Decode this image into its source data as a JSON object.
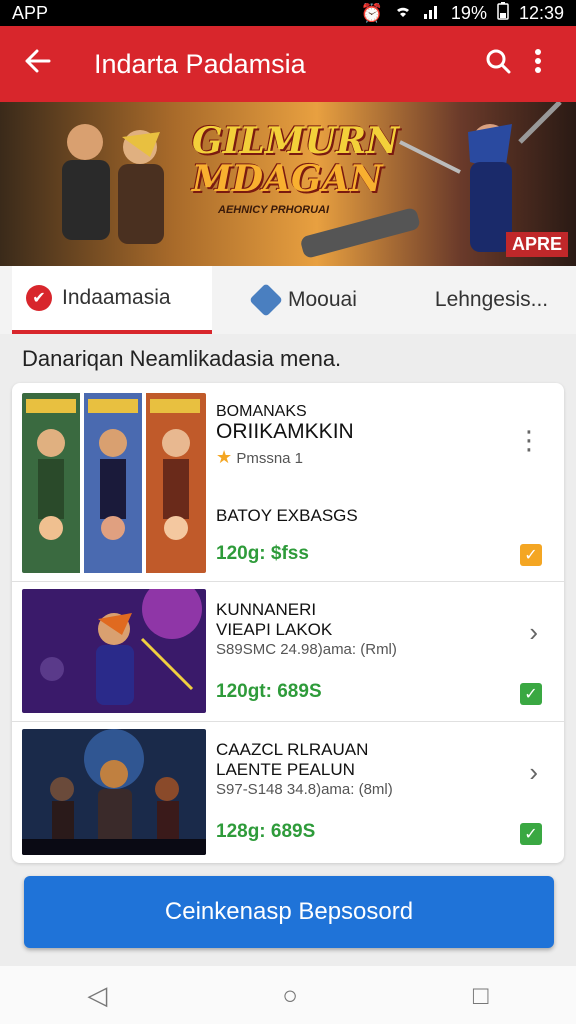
{
  "status": {
    "app": "APP",
    "battery": "19%",
    "time": "12:39",
    "icons": [
      "alarm-icon",
      "wifi-icon",
      "signal-icon",
      "battery-icon"
    ]
  },
  "appbar": {
    "title": "Indarta Padamsia",
    "back_icon": "back-arrow-icon",
    "search_icon": "search-icon",
    "menu_icon": "more-vert-icon"
  },
  "banner": {
    "title1": "GILMURN",
    "title2": "MDAGAN",
    "tagline": "AEHNICY PRHORUAI",
    "badge": "APRE"
  },
  "tabs": [
    {
      "label": "Indaamasia",
      "icon": "brand-badge-icon"
    },
    {
      "label": "Moouai",
      "icon": "shield-icon"
    },
    {
      "label": "Lehngesis..."
    }
  ],
  "subtitle": "Danariqan Neamlikadasia mena.",
  "items": [
    {
      "title1": "BOMANAKS",
      "title2": "ORIIKAMKKIN",
      "rating": "Pmssna 1",
      "subtitle": "BATOY EXBASGS",
      "price": "120g: $fss",
      "status_color": "#f4a623"
    },
    {
      "title1": "KUNNANERI",
      "title2": "VIEAPI LAKOK",
      "meta": "S89SMC 24.98)ama: (Rml)",
      "price": "120gt: 689S",
      "status_color": "#3aa842"
    },
    {
      "title1": "CAAZCL RLRAUAN",
      "title2": "LAENTE PEALUN",
      "meta": "S97-S148 34.8)ama: (8ml)",
      "price": "128g: 689S",
      "status_color": "#3aa842"
    }
  ],
  "cta": "Ceinkenasp Bepsosord",
  "nav": {
    "back": "◁",
    "home": "○",
    "recents": "□"
  },
  "colors": {
    "accent": "#d8262c",
    "cta": "#1f73d8",
    "price": "#2e9b3a"
  }
}
